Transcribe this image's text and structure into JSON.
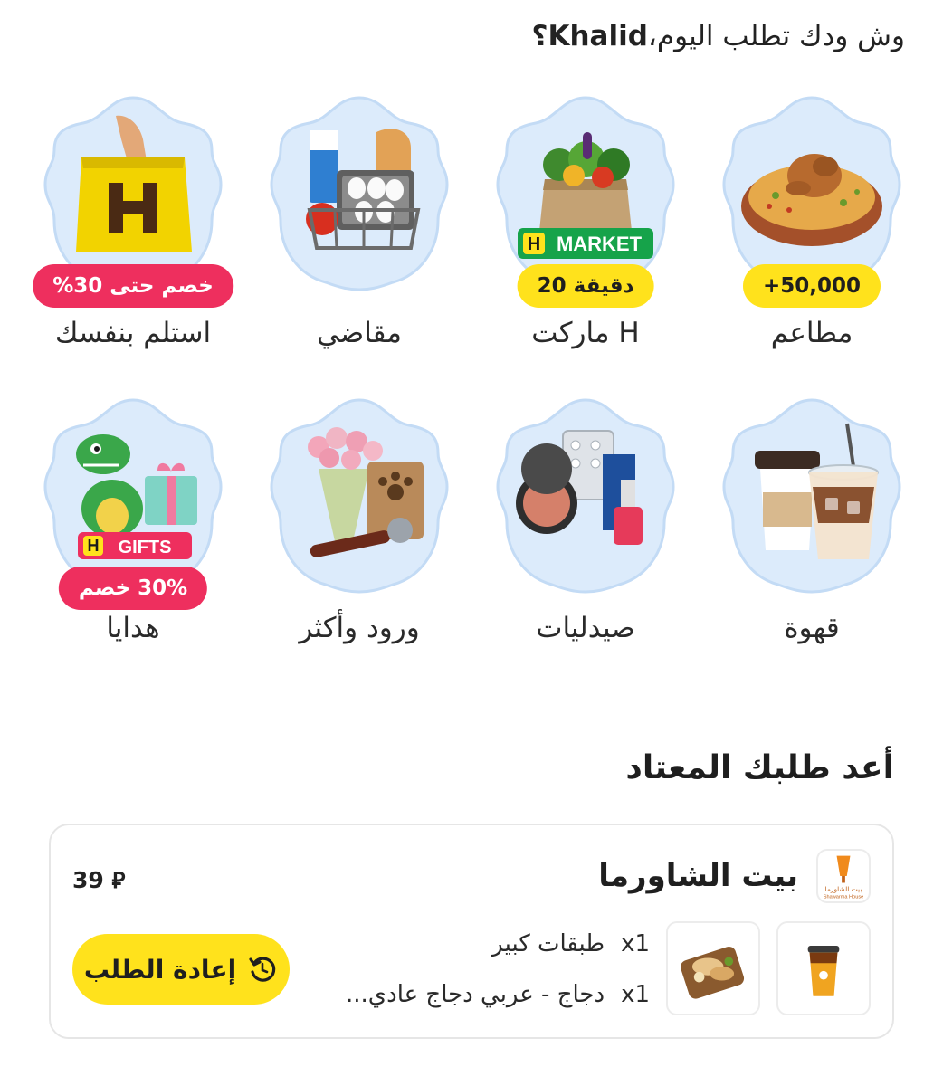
{
  "header": {
    "greeting_before": "وش ودك تطلب اليوم،",
    "user_name": "Khalid",
    "greeting_after": "؟"
  },
  "categories": [
    {
      "label": "مطاعم",
      "badge": "+50,000",
      "badge_style": "yellow",
      "icon": "biryani-chicken-icon"
    },
    {
      "label": "H ماركت",
      "badge": "20 دقيقة",
      "badge_style": "yellow",
      "icon": "grocery-bag-icon",
      "tag": "MARKET"
    },
    {
      "label": "مقاضي",
      "badge": "",
      "icon": "grocery-basket-icon"
    },
    {
      "label": "استلم بنفسك",
      "badge": "خصم حتى 30%",
      "badge_style": "red",
      "icon": "pickup-bag-icon"
    },
    {
      "label": "قهوة",
      "badge": "",
      "icon": "coffee-cups-icon"
    },
    {
      "label": "صيدليات",
      "badge": "",
      "icon": "pharmacy-products-icon"
    },
    {
      "label": "ورود وأكثر",
      "badge": "",
      "icon": "flowers-petfood-icon"
    },
    {
      "label": "هدايا",
      "badge": "30% خصم",
      "badge_style": "red",
      "icon": "gift-dino-icon",
      "tag": "GIFTS"
    }
  ],
  "reorder": {
    "title": "أعد طلبك المعتاد",
    "restaurant": "بيت الشاورما",
    "price": "39",
    "currency_symbol": "⃁",
    "items": [
      {
        "qty": "x1",
        "name": "طبقات كبير"
      },
      {
        "qty": "x1",
        "name": "دجاج - عربي دجاج عادي..."
      }
    ],
    "button_label": "إعادة الطلب",
    "logo_text": "بيت الشاورما",
    "logo_text_en": "Shawarma House"
  },
  "colors": {
    "accent_yellow": "#ffe21c",
    "accent_red": "#ee2f5e",
    "tile_bg": "#dcebfb",
    "tile_border": "#c3dbf5"
  }
}
